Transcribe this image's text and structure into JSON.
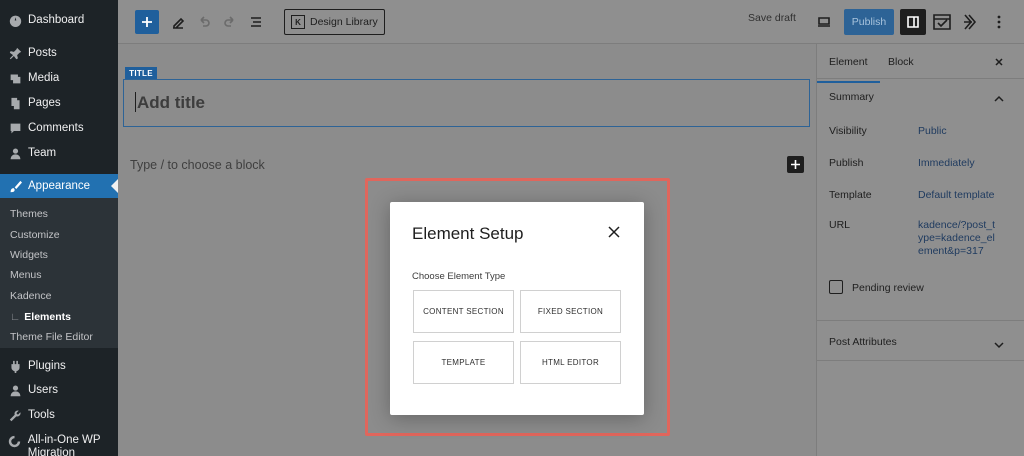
{
  "sidebar": {
    "items": [
      {
        "label": "Dashboard",
        "icon": "dashboard-icon"
      },
      {
        "label": "Posts",
        "icon": "pin-icon"
      },
      {
        "label": "Media",
        "icon": "media-icon"
      },
      {
        "label": "Pages",
        "icon": "pages-icon"
      },
      {
        "label": "Comments",
        "icon": "comment-icon"
      },
      {
        "label": "Team",
        "icon": "user-icon"
      },
      {
        "label": "Appearance",
        "icon": "paintbrush-icon"
      },
      {
        "label": "Plugins",
        "icon": "plugin-icon"
      },
      {
        "label": "Users",
        "icon": "user-icon"
      },
      {
        "label": "Tools",
        "icon": "wrench-icon"
      },
      {
        "label": "All-in-One WP Migration",
        "icon": "migration-icon"
      }
    ],
    "submenu": [
      "Themes",
      "Customize",
      "Widgets",
      "Menus",
      "Kadence",
      "Elements",
      "Theme File Editor"
    ],
    "submenu_prefix": "∟"
  },
  "toolbar": {
    "design_library": "Design Library",
    "save_draft": "Save draft",
    "publish": "Publish"
  },
  "editor": {
    "title_tag": "TITLE",
    "title_placeholder": "Add title",
    "block_placeholder": "Type / to choose a block"
  },
  "panel": {
    "tabs": [
      "Element",
      "Block"
    ],
    "summary_title": "Summary",
    "rows": [
      {
        "label": "Visibility",
        "value": "Public"
      },
      {
        "label": "Publish",
        "value": "Immediately"
      },
      {
        "label": "Template",
        "value": "Default template"
      },
      {
        "label": "URL",
        "value": "kadence/?post_type=kadence_element&p=317"
      }
    ],
    "pending_review": "Pending review",
    "post_attributes": "Post Attributes"
  },
  "modal": {
    "title": "Element Setup",
    "subtitle": "Choose Element Type",
    "options": [
      "CONTENT SECTION",
      "FIXED SECTION",
      "TEMPLATE",
      "HTML EDITOR"
    ]
  },
  "colors": {
    "accent": "#2271b1",
    "highlight": "#e0665c",
    "sidebar": "#1d2327"
  }
}
